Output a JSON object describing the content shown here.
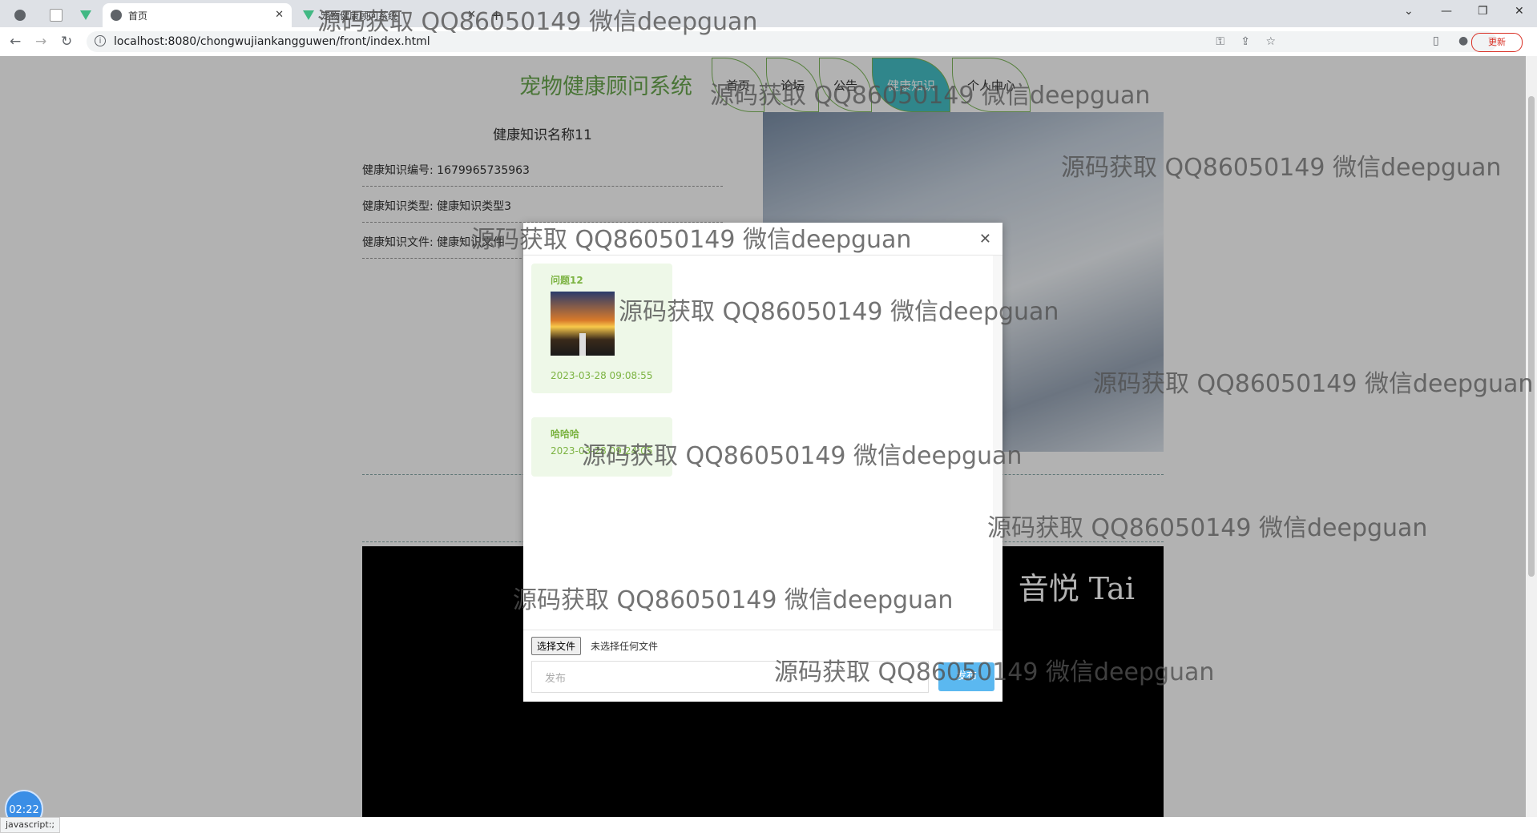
{
  "browser": {
    "tabs": [
      {
        "label": ""
      },
      {
        "label": ""
      },
      {
        "label": ""
      },
      {
        "label": "首页"
      },
      {
        "label": "宠物健康顾问系统"
      }
    ],
    "url": "localhost:8080/chongwujiankangguwen/front/index.html",
    "update_label": "更新"
  },
  "site": {
    "title": "宠物健康顾问系统",
    "nav": [
      "首页",
      "论坛",
      "公告",
      "健康知识",
      "个人中心"
    ]
  },
  "knowledge": {
    "title": "健康知识名称11",
    "number": "健康知识编号: 1679965735963",
    "type": "健康知识类型: 健康知识类型3",
    "file": "健康知识文件: 健康知识文件"
  },
  "video": {
    "caption": "音悦 Tai"
  },
  "modal": {
    "messages": [
      {
        "title": "问题12",
        "time": "2023-03-28 09:08:55",
        "has_image": true
      },
      {
        "title": "哈哈哈",
        "time": "2023-03-28 09:24:05",
        "has_image": false
      }
    ],
    "file_button": "选择文件",
    "file_status": "未选择任何文件",
    "input_placeholder": "发布",
    "send_label": "发布"
  },
  "watermark": "源码获取 QQ86050149 微信deepguan",
  "watermark_top": "源码获取 QQ86050149 微信deepguan",
  "clock": "02:22",
  "status_text": "javascript:;"
}
